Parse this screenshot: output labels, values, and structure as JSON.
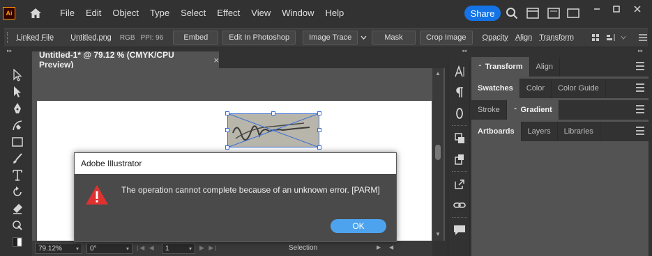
{
  "app": {
    "logo": "Ai"
  },
  "menu": [
    "File",
    "Edit",
    "Object",
    "Type",
    "Select",
    "Effect",
    "View",
    "Window",
    "Help"
  ],
  "header": {
    "share_label": "Share"
  },
  "controlbar": {
    "linked_file": "Linked File",
    "filename": "Untitled.png",
    "color_mode": "RGB",
    "ppi": "PPI: 96",
    "embed": "Embed",
    "edit_photoshop": "Edit In Photoshop",
    "image_trace": "Image Trace",
    "mask": "Mask",
    "crop_image": "Crop Image",
    "opacity": "Opacity",
    "align": "Align",
    "transform": "Transform"
  },
  "document": {
    "tab_title": "Untitled-1* @ 79.12 % (CMYK/CPU Preview)",
    "close_glyph": "×"
  },
  "statusbar": {
    "zoom": "79.12%",
    "rotation": "0°",
    "artboard": "1",
    "mode": "Selection"
  },
  "panels": {
    "row1": [
      "Transform",
      "Align"
    ],
    "row2": [
      "Swatches",
      "Color",
      "Color Guide"
    ],
    "row3": [
      "Stroke",
      "Gradient"
    ],
    "row4": [
      "Artboards",
      "Layers",
      "Libraries"
    ]
  },
  "dialog": {
    "title": "Adobe Illustrator",
    "message": "The operation cannot complete because of an unknown error.   [PARM]",
    "ok_label": "OK"
  },
  "colors": {
    "accent": "#1473e6",
    "ok_button": "#4ea3ee",
    "warning": "#e03131",
    "selection": "#3a6fd8"
  }
}
